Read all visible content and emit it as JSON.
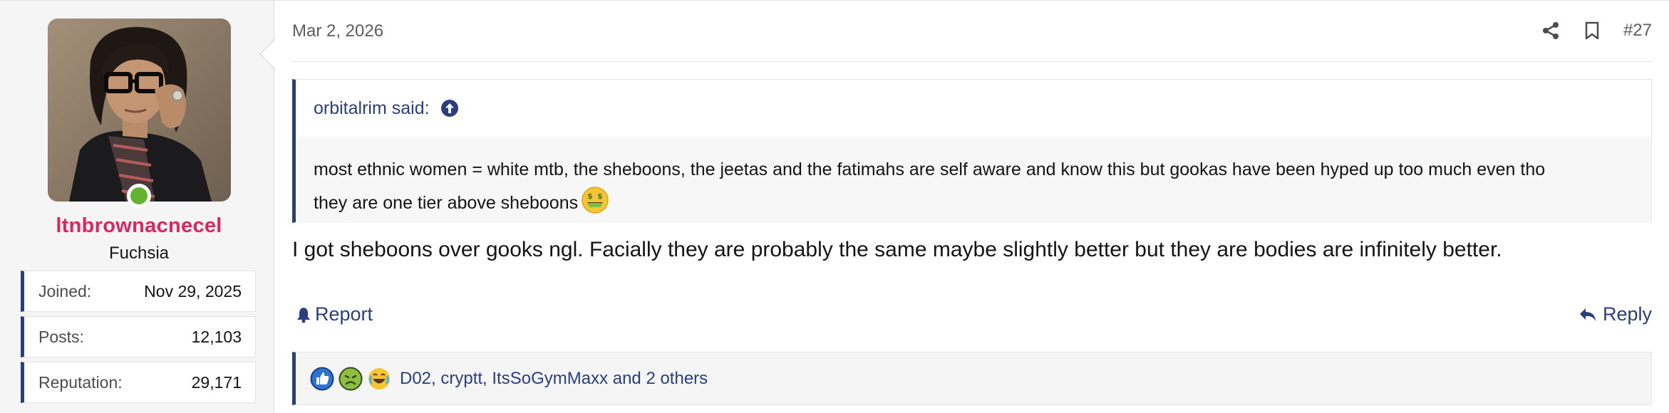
{
  "user": {
    "name": "ltnbrownacnecel",
    "title": "Fuchsia",
    "online": true,
    "stats": [
      {
        "label": "Joined:",
        "value": "Nov 29, 2025"
      },
      {
        "label": "Posts:",
        "value": "12,103"
      },
      {
        "label": "Reputation:",
        "value": "29,171"
      }
    ]
  },
  "post": {
    "date": "Mar 2, 2026",
    "number": "#27",
    "action_icons": [
      "share-icon",
      "bookmark-icon"
    ],
    "quote": {
      "author": "orbitalrim said:",
      "line1": "most ethnic women = white mtb, the sheboons, the jeetas and the fatimahs are self aware and know this but gookas have been hyped up too much even tho",
      "line2": "they are one tier above sheboons",
      "emoji": "money-mouth-face-emoji"
    },
    "message": "I got sheboons over gooks ngl. Facially they are probably the same maybe slightly better but they are bodies are infinitely better.",
    "report_label": "Report",
    "reply_label": "Reply",
    "reactions": {
      "icons": [
        "like-icon",
        "sick-face-icon",
        "laughing-face-icon"
      ],
      "users_text": "D02, cryptt, ItsSoGymMaxx and 2 others"
    }
  },
  "colors": {
    "accent": "#2b3e7e",
    "username": "#e0245e",
    "online": "#63b32e"
  }
}
